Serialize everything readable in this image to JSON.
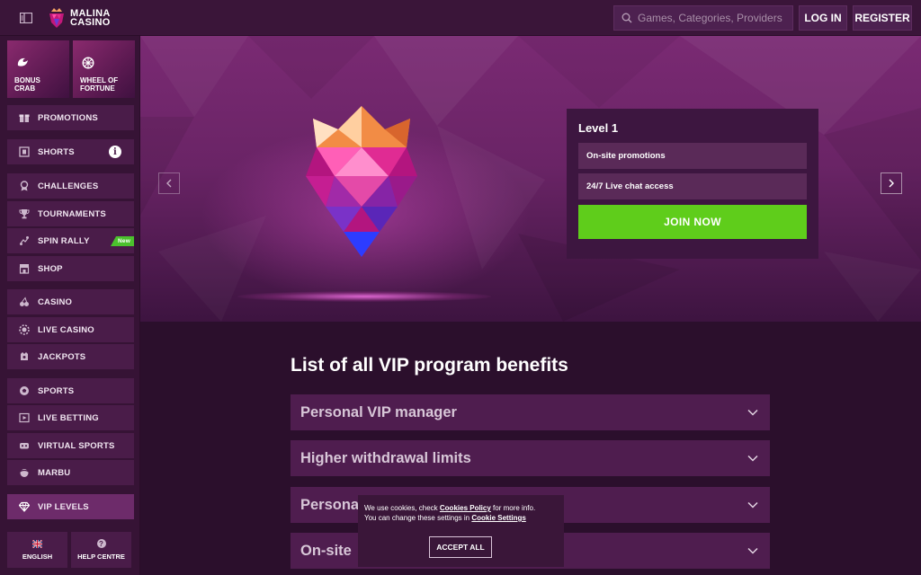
{
  "header": {
    "logo": {
      "line1": "MALINA",
      "line2": "CASINO"
    },
    "search_placeholder": "Games, Categories, Providers",
    "login_label": "LOG IN",
    "register_label": "REGISTER"
  },
  "sidebar": {
    "tiles": [
      {
        "label": "BONUS\nCRAB",
        "icon": "crab-claw-icon"
      },
      {
        "label": "WHEEL OF\nFORTUNE",
        "icon": "wheel-icon"
      }
    ],
    "items": [
      {
        "label": "PROMOTIONS",
        "icon": "gift-icon"
      },
      {
        "label": "SHORTS",
        "icon": "film-icon",
        "info": "i"
      },
      {
        "label": "CHALLENGES",
        "icon": "medal-icon"
      },
      {
        "label": "TOURNAMENTS",
        "icon": "trophy-icon"
      },
      {
        "label": "SPIN RALLY",
        "icon": "rally-icon",
        "badge": "New"
      },
      {
        "label": "SHOP",
        "icon": "shop-icon"
      },
      {
        "label": "CASINO",
        "icon": "cherries-icon"
      },
      {
        "label": "LIVE CASINO",
        "icon": "chip-icon"
      },
      {
        "label": "JACKPOTS",
        "icon": "jackpot-icon"
      },
      {
        "label": "SPORTS",
        "icon": "ball-icon"
      },
      {
        "label": "LIVE BETTING",
        "icon": "live-icon"
      },
      {
        "label": "VIRTUAL SPORTS",
        "icon": "virtual-icon"
      },
      {
        "label": "MARBU",
        "icon": "marbu-icon"
      },
      {
        "label": "VIP LEVELS",
        "icon": "diamond-icon",
        "active": true
      }
    ],
    "bottom": [
      {
        "label": "ENGLISH",
        "icon": "uk-flag-icon"
      },
      {
        "label": "HELP CENTRE",
        "icon": "help-icon",
        "glyph": "?"
      }
    ]
  },
  "hero": {
    "level_title": "Level 1",
    "benefits": [
      "On-site promotions",
      "24/7 Live chat access"
    ],
    "join_label": "JOIN NOW"
  },
  "content": {
    "title": "List of all VIP program benefits",
    "accordion": [
      "Personal VIP manager",
      "Higher withdrawal limits",
      "Personal",
      "On-site"
    ]
  },
  "cookie": {
    "text1": "We use cookies, check ",
    "policy_link": "Cookies Policy",
    "text2": " for more info.",
    "text3": "You can change these settings in ",
    "settings_link": "Cookie Settings",
    "accept_label": "ACCEPT ALL"
  },
  "colors": {
    "accent_green": "#5fcd1b",
    "background": "#2b0f2c",
    "panel": "#4f1d4f"
  }
}
